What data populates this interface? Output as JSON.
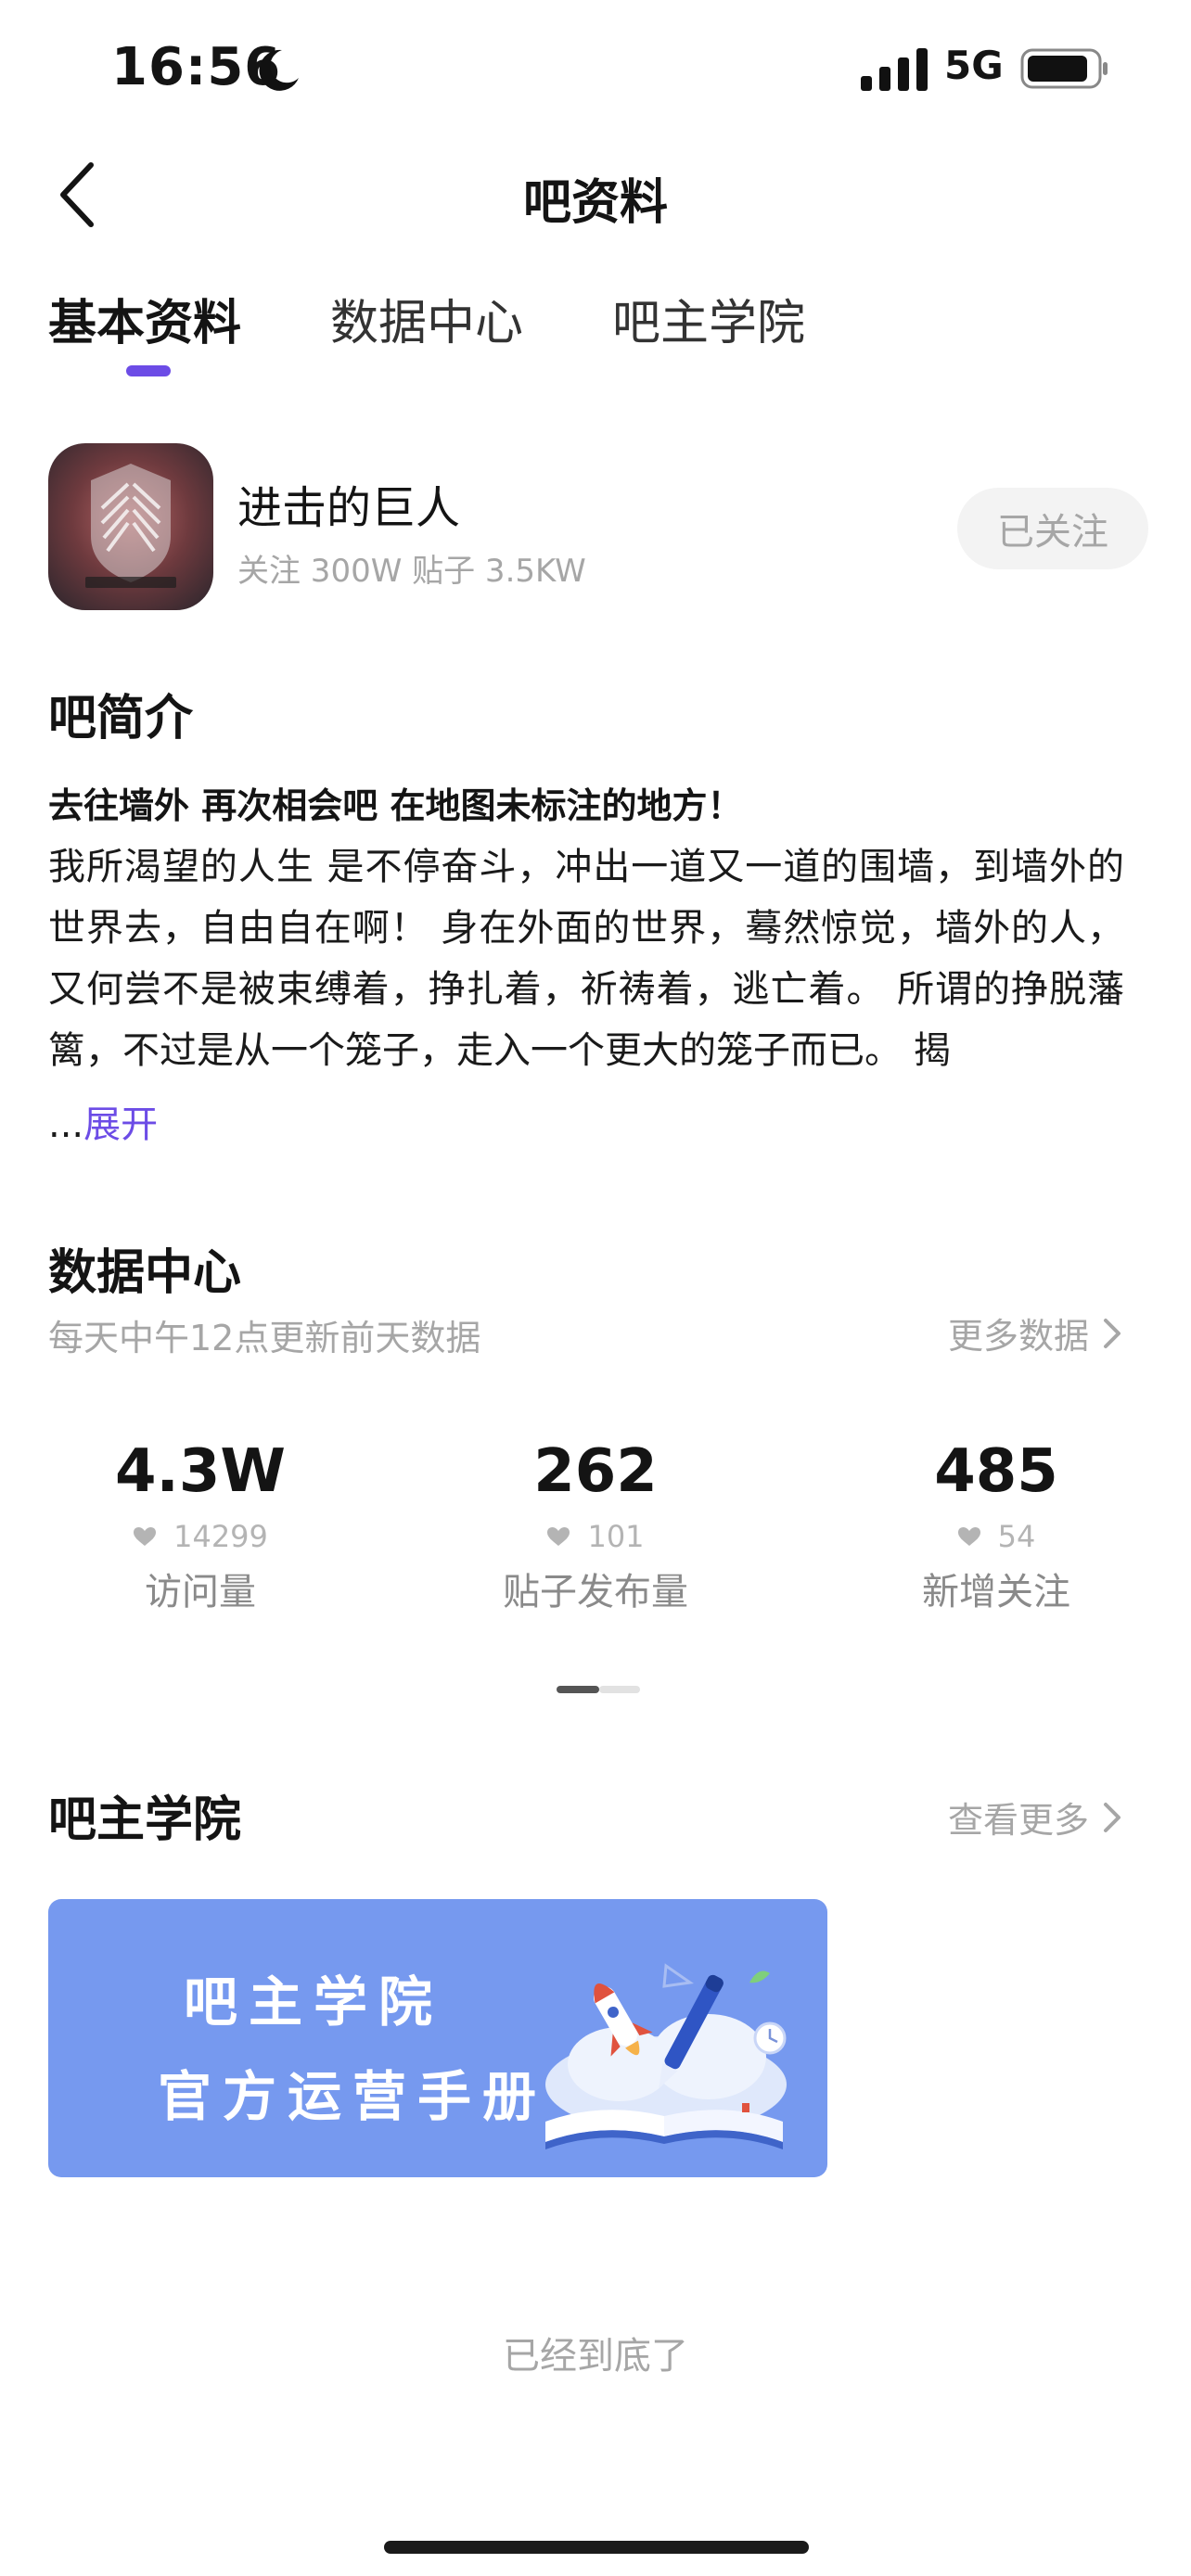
{
  "status_bar": {
    "time": "16:56",
    "network": "5G",
    "moon_icon": "moon-icon",
    "signal_icon": "cellular-signal-icon",
    "battery_icon": "battery-icon"
  },
  "nav": {
    "title": "吧资料",
    "back_icon": "chevron-left-icon"
  },
  "tabs": [
    {
      "label": "基本资料",
      "active": true
    },
    {
      "label": "数据中心",
      "active": false
    },
    {
      "label": "吧主学院",
      "active": false
    }
  ],
  "forum": {
    "name": "进击的巨人",
    "stats": "关注 300W   贴子 3.5KW",
    "follow_label": "已关注",
    "avatar_icon": "forum-avatar-wings-emblem"
  },
  "intro": {
    "title": "吧简介",
    "headline": "去往墙外 再次相会吧 在地图未标注的地方！",
    "body": "我所渴望的人生 是不停奋斗，冲出一道又一道的围墙，到墙外的世界去，自由自在啊！ 身在外面的世界，蓦然惊觉，墙外的人，又何尝不是被束缚着，挣扎着，祈祷着，逃亡着。 所谓的挣脱藩篱，不过是从一个笼子，走入一个更大的笼子而已。 揭",
    "ellipsis": "...",
    "expand_label": "展开"
  },
  "data_center": {
    "title": "数据中心",
    "subtitle": "每天中午12点更新前天数据",
    "more_label": "更多数据",
    "stats": [
      {
        "value": "4.3W",
        "delta": "14299",
        "label": "访问量"
      },
      {
        "value": "262",
        "delta": "101",
        "label": "贴子发布量"
      },
      {
        "value": "485",
        "delta": "54",
        "label": "新增关注"
      }
    ]
  },
  "academy": {
    "title": "吧主学院",
    "more_label": "查看更多",
    "banner_line1": "吧主学院",
    "banner_line2": "官方运营手册",
    "banner_icon": "open-book-rocket-pen-illustration"
  },
  "footer": {
    "end_text": "已经到底了"
  },
  "colors": {
    "accent": "#6c4ce6",
    "banner_bg": "#7699ef",
    "muted_text": "#a6a6a6"
  }
}
